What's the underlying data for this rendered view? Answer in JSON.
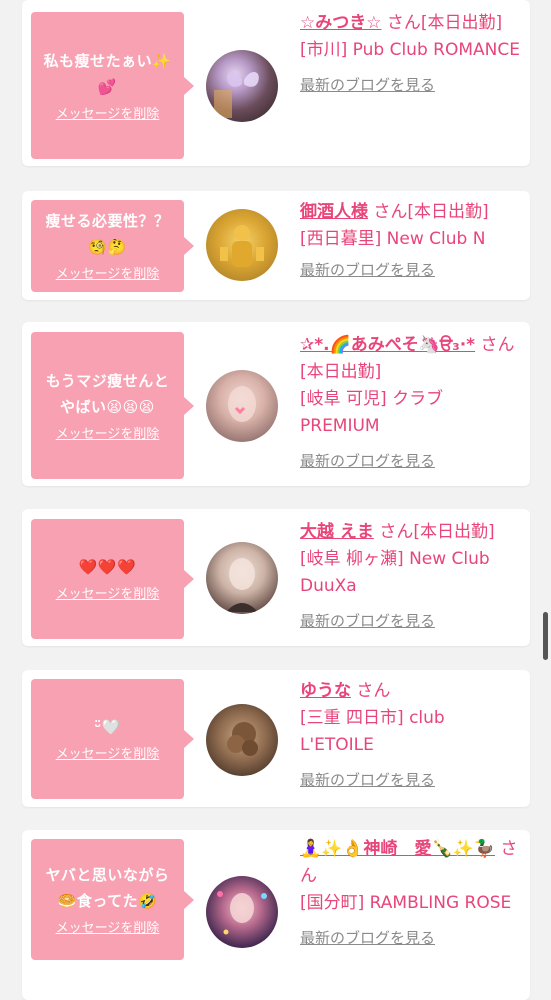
{
  "delete_label": "メッセージを削除",
  "blog_label": "最新のブログを見る",
  "entries": [
    {
      "message": "私も痩せたぁい✨💕",
      "name": "☆みつき☆",
      "suffix": "さん[本日出勤]",
      "shop": "[市川] Pub Club ROMANCE"
    },
    {
      "message": "痩せる必要性？？🧐🤔",
      "name": "御酒人様",
      "suffix": "さん[本日出勤]",
      "shop": "[西日暮里] New Club N"
    },
    {
      "message": "もうマジ痩せんとやばい😫😫😫",
      "name": "✰*.🌈あみぺそ🦄ੳ₃·*",
      "suffix": "さん[本日出勤]",
      "shop": "[岐阜 可児] クラブ PREMIUM"
    },
    {
      "message": "❤️❤️❤️",
      "name": "大越 えま",
      "suffix": "さん[本日出勤]",
      "shop": "[岐阜 柳ヶ瀬] New Club DuuXa"
    },
    {
      "message": "ᵕ̈🤍",
      "name": "ゆうな",
      "suffix": "さん",
      "shop": "[三重 四日市] club L'ETOILE"
    },
    {
      "message": "ヤバと思いながら🥯食ってた🤣",
      "name": "🧘‍♀️✨👌神崎　愛🍾✨🦆",
      "suffix": "さん",
      "shop": "[国分町] RAMBLING ROSE"
    }
  ],
  "colors": {
    "accent": "#e8457a",
    "bubble": "#f7a1b2",
    "card": "#ffffff",
    "background": "#f2f2f2",
    "link_gray": "#8a8a8a"
  }
}
